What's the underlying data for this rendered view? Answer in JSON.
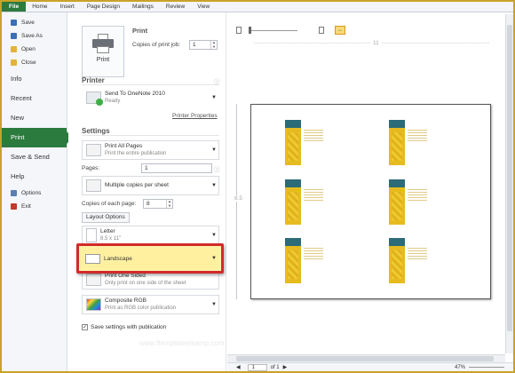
{
  "ribbon": {
    "tabs": [
      "File",
      "Home",
      "Insert",
      "Page Design",
      "Mailings",
      "Review",
      "View"
    ]
  },
  "nav": {
    "small_top": [
      {
        "label": "Save",
        "icon": "save-icon",
        "color": "#3b6fb6"
      },
      {
        "label": "Save As",
        "icon": "save-as-icon",
        "color": "#3b6fb6"
      },
      {
        "label": "Open",
        "icon": "open-folder-icon",
        "color": "#e3b33a"
      },
      {
        "label": "Close",
        "icon": "close-folder-icon",
        "color": "#e3b33a"
      }
    ],
    "big": [
      "Info",
      "Recent",
      "New",
      "Print",
      "Save & Send",
      "Help"
    ],
    "active": "Print",
    "small_bottom": [
      {
        "label": "Options",
        "icon": "options-icon",
        "color": "#5a7fb0"
      },
      {
        "label": "Exit",
        "icon": "exit-icon",
        "color": "#c0392b"
      }
    ]
  },
  "print": {
    "heading": "Print",
    "button_label": "Print",
    "copies_label": "Copies of print job:",
    "copies_value": "1",
    "printer_heading": "Printer",
    "printer_name": "Send To OneNote 2010",
    "printer_status": "Ready",
    "printer_properties": "Printer Properties",
    "settings_heading": "Settings",
    "pages_option": {
      "main": "Print All Pages",
      "sub": "Print the entire publication"
    },
    "pages_label": "Pages:",
    "pages_value": "1",
    "layout_option": "Multiple copies per sheet",
    "copies_each_label": "Copies of each page:",
    "copies_each_value": "8",
    "layout_options_button": "Layout Options",
    "paper_option": {
      "main": "Letter",
      "sub": "8.5 x 11\""
    },
    "orientation_option": "Landscape",
    "sides_option": {
      "main": "Print One Sided",
      "sub": "Only print on one side of the sheet"
    },
    "color_option": {
      "main": "Composite RGB",
      "sub": "Print as RGB color publication"
    },
    "save_settings_label": "Save settings with publication",
    "highlight_color": "#d22a2a"
  },
  "preview": {
    "ruler_label": "11",
    "ruler_v_label": "8.5",
    "page_field": "1",
    "page_of": "of 1",
    "zoom": "47%",
    "watermark": "www.ftemplatesteamp.com"
  }
}
